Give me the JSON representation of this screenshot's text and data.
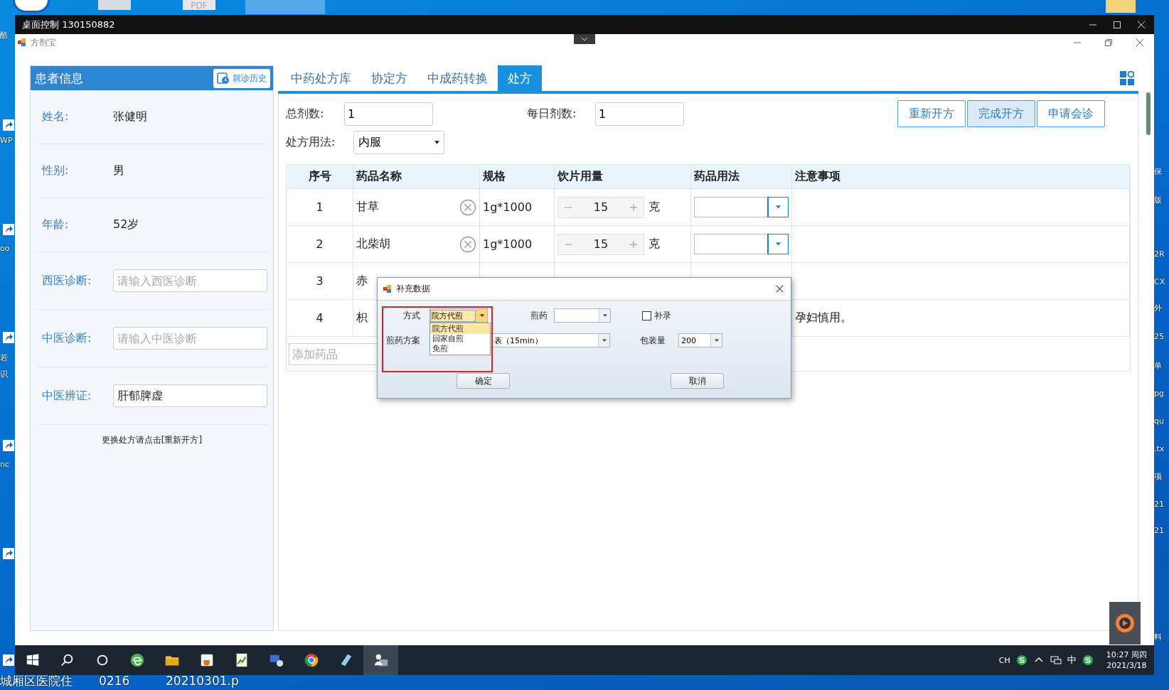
{
  "desktop": {
    "top_labels": [
      "PDF"
    ],
    "left_labels": [
      "酷",
      "WP",
      "oo",
      "若",
      "识",
      "nc"
    ],
    "right_labels": [
      "保",
      "版",
      "2R",
      "CX",
      "外",
      "25",
      "单",
      "pg",
      "qu",
      ".tx",
      "项",
      "21",
      "21",
      "料"
    ],
    "bottom_labels": [
      "城厢区医院住",
      "0216",
      "20210301.p"
    ]
  },
  "remote_window": {
    "title": "桌面控制 130150882"
  },
  "app": {
    "title": "方剂宝"
  },
  "patient_panel": {
    "title": "患者信息",
    "history_button": "就诊历史",
    "fields": [
      {
        "kind": "text",
        "label": "姓名:",
        "value": "张健明"
      },
      {
        "kind": "text",
        "label": "性别:",
        "value": "男"
      },
      {
        "kind": "text",
        "label": "年龄:",
        "value": "52岁"
      },
      {
        "kind": "input",
        "label": "西医诊断:",
        "placeholder": "请输入西医诊断"
      },
      {
        "kind": "input",
        "label": "中医诊断:",
        "placeholder": "请输入中医诊断"
      },
      {
        "kind": "input",
        "label": "中医辨证:",
        "value": "肝郁脾虚"
      }
    ],
    "hint": "更换处方请点击[重新开方]"
  },
  "tabs": [
    {
      "label": "中药处方库",
      "selected": false
    },
    {
      "label": "协定方",
      "selected": false
    },
    {
      "label": "中成药转换",
      "selected": false
    },
    {
      "label": "处方",
      "selected": true
    }
  ],
  "form": {
    "total_doses": {
      "label": "总剂数:",
      "value": "1"
    },
    "daily_doses": {
      "label": "每日剂数:",
      "value": "1"
    },
    "usage": {
      "label": "处方用法:",
      "value": "内服"
    },
    "buttons": [
      {
        "label": "重新开方",
        "highlighted": false
      },
      {
        "label": "完成开方",
        "highlighted": true
      },
      {
        "label": "申请会诊",
        "highlighted": false
      }
    ]
  },
  "table": {
    "columns": [
      "序号",
      "药品名称",
      "规格",
      "饮片用量",
      "药品用法",
      "注意事项"
    ],
    "rows": [
      {
        "index": "1",
        "name": "甘草",
        "spec": "1g*1000",
        "quantity": "15",
        "unit": "克"
      },
      {
        "index": "2",
        "name": "北柴胡",
        "spec": "1g*1000",
        "quantity": "15",
        "unit": "克"
      },
      {
        "index": "3",
        "name": "赤"
      },
      {
        "index": "4",
        "name": "枳",
        "note": "孕妇慎用。"
      }
    ],
    "add_placeholder": "添加药品"
  },
  "dialog": {
    "title": "补充数据",
    "method": {
      "label": "方式",
      "value": "院方代煎",
      "options": [
        {
          "label": "院方代煎",
          "selected": true
        },
        {
          "label": "回家自煎",
          "selected": false
        },
        {
          "label": "免煎",
          "selected": false
        }
      ]
    },
    "decoct": {
      "label": "煎药"
    },
    "supplement": {
      "label": "补录",
      "checked": false
    },
    "plan": {
      "label": "煎药方案",
      "value": "表（15min）"
    },
    "package": {
      "label": "包装量",
      "value": "200"
    },
    "buttons": [
      "确定",
      "取消"
    ]
  },
  "taskbar": {
    "lang": "CH",
    "ime": "中",
    "time": "10:27 周四",
    "date": "2021/3/18"
  }
}
